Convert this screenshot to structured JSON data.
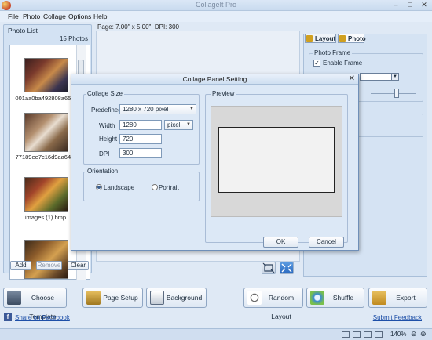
{
  "window": {
    "title": "CollageIt Pro"
  },
  "menu": [
    "File",
    "Photo",
    "Collage",
    "Options",
    "Help"
  ],
  "page_info": "Page:  7.00\" x 5.00\",  DPI: 300",
  "photo_list": {
    "title": "Photo List",
    "count": "15 Photos",
    "items": [
      {
        "caption": "001aa0ba492808a65..."
      },
      {
        "caption": "77189ee7c16d9aa64..."
      },
      {
        "caption": "images (1).bmp"
      }
    ],
    "add_label": "Add",
    "remove_label": "Remove",
    "clear_label": "Clear"
  },
  "right_panel": {
    "tab_layout": "Layout",
    "tab_photo": "Photo",
    "frame_group": "Photo Frame",
    "enable_frame_label": "Enable Frame",
    "enable_frame_checked": true
  },
  "dialog": {
    "title": "Collage Panel Setting",
    "collage_size_label": "Collage Size",
    "predefined_label": "Predefined",
    "predefined_value": "1280 x 720 pixel",
    "width_label": "Width",
    "width_value": "1280",
    "unit_value": "pixel",
    "height_label": "Height",
    "height_value": "720",
    "dpi_label": "DPI",
    "dpi_value": "300",
    "orientation_label": "Orientation",
    "landscape_label": "Landscape",
    "portrait_label": "Portrait",
    "orientation_selected": "Landscape",
    "preview_label": "Preview",
    "ok_label": "OK",
    "cancel_label": "Cancel"
  },
  "toolbar": {
    "choose_template": "Choose Template",
    "page_setup": "Page Setup",
    "background": "Background",
    "random_layout": "Random Layout",
    "shuffle": "Shuffle",
    "export": "Export"
  },
  "links": {
    "share": "Share on Facebook",
    "feedback": "Submit Feedback"
  },
  "status": {
    "zoom": "140%"
  },
  "colors": {
    "window_bg": "#dfe9f5",
    "panel_bg": "#d3e2f3",
    "dialog_bg": "#dce8f6",
    "link": "#1d4fa8"
  }
}
